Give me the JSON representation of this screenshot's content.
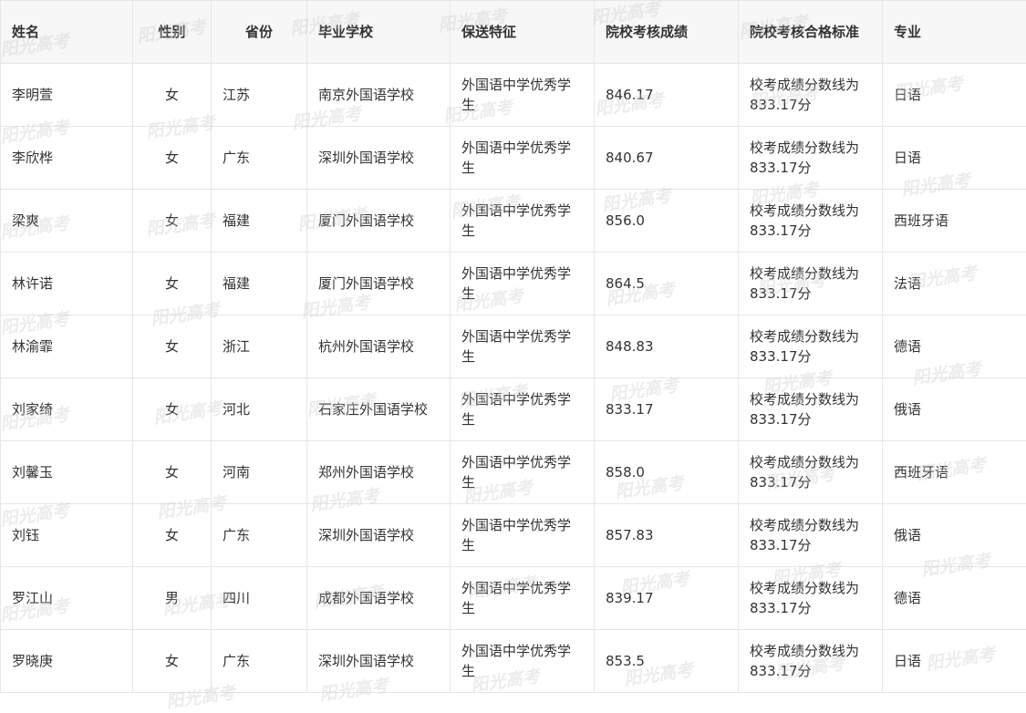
{
  "watermark": "阳光高考",
  "headers": [
    "姓名",
    "性别",
    "省份",
    "毕业学校",
    "保送特征",
    "院校考核成绩",
    "院校考核合格标准",
    "专业"
  ],
  "rows": [
    [
      "李明萱",
      "女",
      "江苏",
      "南京外国语学校",
      "外国语中学优秀学生",
      "846.17",
      "校考成绩分数线为833.17分",
      "日语"
    ],
    [
      "李欣桦",
      "女",
      "广东",
      "深圳外国语学校",
      "外国语中学优秀学生",
      "840.67",
      "校考成绩分数线为833.17分",
      "日语"
    ],
    [
      "梁爽",
      "女",
      "福建",
      "厦门外国语学校",
      "外国语中学优秀学生",
      "856.0",
      "校考成绩分数线为833.17分",
      "西班牙语"
    ],
    [
      "林许诺",
      "女",
      "福建",
      "厦门外国语学校",
      "外国语中学优秀学生",
      "864.5",
      "校考成绩分数线为833.17分",
      "法语"
    ],
    [
      "林渝霏",
      "女",
      "浙江",
      "杭州外国语学校",
      "外国语中学优秀学生",
      "848.83",
      "校考成绩分数线为833.17分",
      "德语"
    ],
    [
      "刘家绮",
      "女",
      "河北",
      "石家庄外国语学校",
      "外国语中学优秀学生",
      "833.17",
      "校考成绩分数线为833.17分",
      "俄语"
    ],
    [
      "刘馨玉",
      "女",
      "河南",
      "郑州外国语学校",
      "外国语中学优秀学生",
      "858.0",
      "校考成绩分数线为833.17分",
      "西班牙语"
    ],
    [
      "刘钰",
      "女",
      "广东",
      "深圳外国语学校",
      "外国语中学优秀学生",
      "857.83",
      "校考成绩分数线为833.17分",
      "俄语"
    ],
    [
      "罗江山",
      "男",
      "四川",
      "成都外国语学校",
      "外国语中学优秀学生",
      "839.17",
      "校考成绩分数线为833.17分",
      "德语"
    ],
    [
      "罗晓庚",
      "女",
      "广东",
      "深圳外国语学校",
      "外国语中学优秀学生",
      "853.5",
      "校考成绩分数线为833.17分",
      "日语"
    ]
  ]
}
